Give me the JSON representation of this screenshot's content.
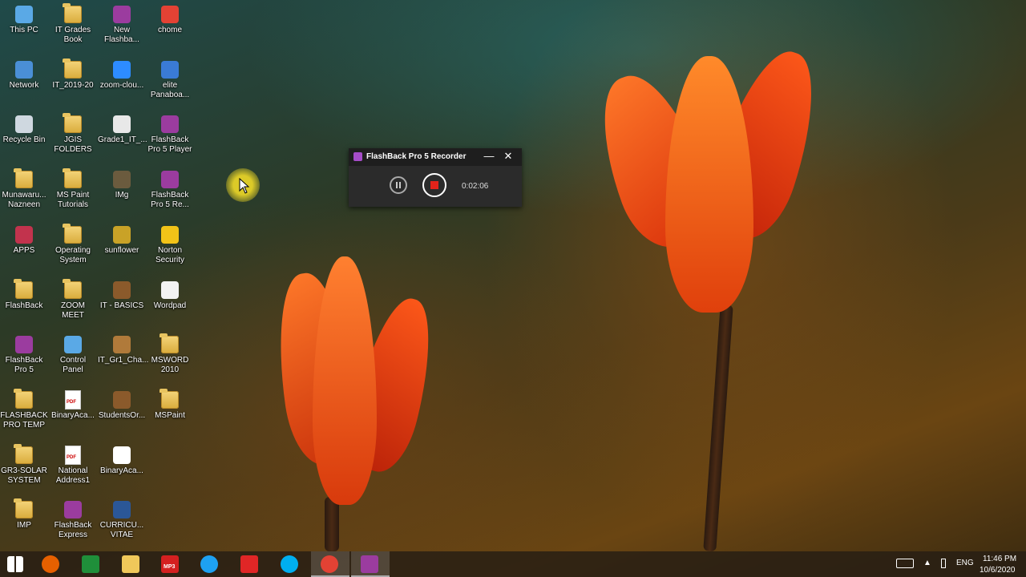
{
  "desktop": {
    "icons": [
      {
        "label": "This PC",
        "icon": "computer-icon",
        "color": "#5aa9e6"
      },
      {
        "label": "IT Grades\nBook",
        "icon": "folder-icon"
      },
      {
        "label": "New\nFlashba...",
        "icon": "flashback-icon",
        "color": "#9b3c9f"
      },
      {
        "label": "chome",
        "icon": "chrome-icon",
        "color": "#e34234"
      },
      {
        "label": "Network",
        "icon": "network-icon",
        "color": "#4a8fd6"
      },
      {
        "label": "IT_2019-20",
        "icon": "folder-icon"
      },
      {
        "label": "zoom-clou...",
        "icon": "zoom-icon",
        "color": "#2d8cff"
      },
      {
        "label": "elite\nPanaboa...",
        "icon": "elite-icon",
        "color": "#3a7bd5"
      },
      {
        "label": "Recycle Bin",
        "icon": "recycle-bin-icon",
        "color": "#cfd8e0"
      },
      {
        "label": "JGIS FOLDERS",
        "icon": "folder-icon"
      },
      {
        "label": "Grade1_IT_...",
        "icon": "image-file-icon",
        "color": "#e8e8e8"
      },
      {
        "label": "FlashBack\nPro 5 Player",
        "icon": "flashback-player-icon",
        "color": "#9b3c9f"
      },
      {
        "label": "Munawaru...\nNazneen",
        "icon": "folder-icon"
      },
      {
        "label": "MS Paint\nTutorials",
        "icon": "folder-icon"
      },
      {
        "label": "IMg",
        "icon": "image-icon",
        "color": "#6b5b3e"
      },
      {
        "label": "FlashBack\nPro 5 Re...",
        "icon": "flashback-recorder-icon",
        "color": "#9b3c9f"
      },
      {
        "label": "APPS",
        "icon": "apps-folder-icon",
        "color": "#c2334d"
      },
      {
        "label": "Operating\nSystem",
        "icon": "folder-icon"
      },
      {
        "label": "sunflower",
        "icon": "image-icon",
        "color": "#c9a227"
      },
      {
        "label": "Norton\nSecurity",
        "icon": "norton-icon",
        "color": "#f2c318"
      },
      {
        "label": "FlashBack",
        "icon": "folder-icon"
      },
      {
        "label": "ZOOM MEET",
        "icon": "folder-icon"
      },
      {
        "label": "IT - BASICS",
        "icon": "image-icon",
        "color": "#8b5a2b"
      },
      {
        "label": "Wordpad",
        "icon": "wordpad-icon",
        "color": "#f2f2f2"
      },
      {
        "label": "FlashBack\nPro 5",
        "icon": "flashback-icon",
        "color": "#9b3c9f"
      },
      {
        "label": "Control Panel",
        "icon": "control-panel-icon",
        "color": "#5aa9e6"
      },
      {
        "label": "IT_Gr1_Cha...",
        "icon": "image-icon",
        "color": "#b07a3a"
      },
      {
        "label": "MSWORD\n2010",
        "icon": "folder-icon"
      },
      {
        "label": "FLASHBACK\nPRO TEMP",
        "icon": "folder-icon"
      },
      {
        "label": "BinaryAca...",
        "icon": "pdf-icon",
        "color": "#ffffff"
      },
      {
        "label": "StudentsOr...",
        "icon": "image-icon",
        "color": "#8b5a2b"
      },
      {
        "label": "MSPaint",
        "icon": "folder-icon"
      },
      {
        "label": "GR3-SOLAR\nSYSTEM",
        "icon": "folder-icon"
      },
      {
        "label": "National\nAddress1",
        "icon": "pdf-icon",
        "color": "#ffffff"
      },
      {
        "label": "BinaryAca...",
        "icon": "document-icon",
        "color": "#ffffff"
      },
      {
        "label": "",
        "icon": "",
        "color": ""
      },
      {
        "label": "IMP",
        "icon": "folder-icon"
      },
      {
        "label": "FlashBack\nExpress",
        "icon": "flashback-express-icon",
        "color": "#9b3c9f"
      },
      {
        "label": "CURRICU...\nVITAE",
        "icon": "word-doc-icon",
        "color": "#2b5797"
      },
      {
        "label": "",
        "icon": "",
        "color": ""
      }
    ]
  },
  "recorder": {
    "title": "FlashBack Pro 5 Recorder",
    "minimize_glyph": "—",
    "close_glyph": "✕",
    "elapsed": "0:02:06",
    "stop_color": "#e2231a"
  },
  "taskbar": {
    "apps": [
      {
        "name": "start-button",
        "icon": "windows-icon",
        "color": "#ffffff"
      },
      {
        "name": "taskbar-firefox",
        "icon": "firefox-icon",
        "color": "#e66000"
      },
      {
        "name": "taskbar-store",
        "icon": "store-icon",
        "color": "#1f8f3a"
      },
      {
        "name": "taskbar-file-explorer",
        "icon": "folder-icon",
        "color": "#f0c85a"
      },
      {
        "name": "taskbar-mp3",
        "icon": "mp3-icon",
        "color": "#d42020"
      },
      {
        "name": "taskbar-internet-explorer",
        "icon": "ie-icon",
        "color": "#1ea1f2"
      },
      {
        "name": "taskbar-downloader",
        "icon": "download-icon",
        "color": "#e02626"
      },
      {
        "name": "taskbar-skype",
        "icon": "skype-icon",
        "color": "#00aff0"
      },
      {
        "name": "taskbar-chrome",
        "icon": "chrome-icon",
        "color": "#e34234"
      },
      {
        "name": "taskbar-flashback",
        "icon": "flashback-icon",
        "color": "#9b3c9f"
      }
    ],
    "mp3_label": "MP3",
    "language": "ENG",
    "clock_time": "11:46 PM",
    "clock_date": "10/6/2020"
  }
}
